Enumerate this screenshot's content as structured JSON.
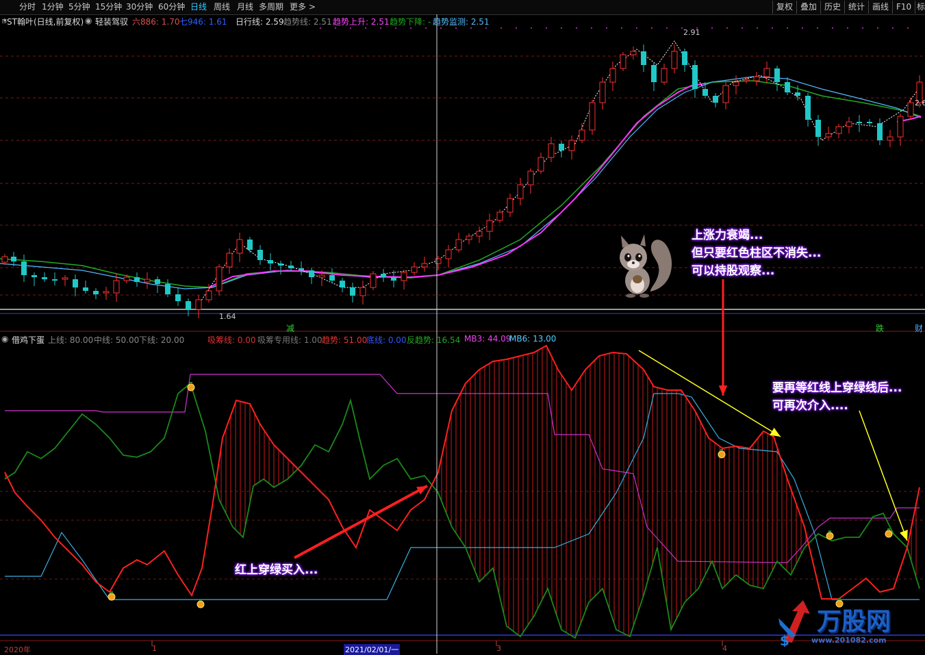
{
  "toolbar": {
    "periods": [
      "分时",
      "1分钟",
      "5分钟",
      "15分钟",
      "30分钟",
      "60分钟",
      "日线",
      "周线",
      "月线",
      "多周期",
      "更多 >"
    ],
    "selected_period": "日线",
    "right_buttons": [
      "复权",
      "叠加",
      "历史",
      "统计",
      "画线",
      "F10",
      "标"
    ]
  },
  "main_chart": {
    "stock": "*ST翰叶(日线,前复权)",
    "indicator_name": "轻装驾驭",
    "ma_items": [
      {
        "label": "六886: 1.70",
        "color": "#e05050"
      },
      {
        "label": "七946: 1.61",
        "color": "#3060ff"
      },
      {
        "label": "日行线: 2.59",
        "color": "#dddddd"
      },
      {
        "label": "趋势线: 2.51",
        "color": "#888888"
      },
      {
        "label": "趋势上升: 2.51",
        "color": "#ff44ff"
      },
      {
        "label": "趋势下降: -",
        "color": "#22aa22"
      },
      {
        "label": "趋势监测: 2.51",
        "color": "#55bbff"
      }
    ],
    "high_label": "2.91",
    "low_label": "1.64",
    "right_price": "2.6",
    "markers": [
      {
        "text": "减",
        "color": "#33cc33"
      },
      {
        "text": "跌",
        "color": "#33cc33"
      },
      {
        "text": "财",
        "color": "#55aaff"
      }
    ]
  },
  "sub_chart": {
    "name": "借鸡下蛋",
    "params": [
      {
        "label": "上线: 80.00",
        "color": "#888888"
      },
      {
        "label": "中线: 50.00",
        "color": "#888888"
      },
      {
        "label": "下线: 20.00",
        "color": "#888888"
      },
      {
        "label": "吸筹线: 0.00",
        "color": "#dd3333"
      },
      {
        "label": "吸筹专用线: 1.00",
        "color": "#777777"
      },
      {
        "label": "趋势: 51.00",
        "color": "#ee3333"
      },
      {
        "label": "底线: 0.00",
        "color": "#3355ff"
      },
      {
        "label": "反趋势: 16.54",
        "color": "#22aa22"
      },
      {
        "label": "MB3: 44.09",
        "color": "#ee44ee"
      },
      {
        "label": "MB6: 13.00",
        "color": "#55ccff"
      }
    ]
  },
  "annotations": {
    "buy": "红上穿绿买入...",
    "hold": [
      "上涨力衰竭...",
      "但只要红色柱区不消失...",
      "可以持股观察..."
    ],
    "reenter": [
      "要再等红线上穿绿线后...",
      "可再次介入...."
    ]
  },
  "time_axis": {
    "labels": [
      "2020年",
      "1",
      "2021/02/01/一",
      "3",
      "4"
    ]
  },
  "watermark": {
    "logo": "万股网",
    "url": "www.201082.com"
  }
}
